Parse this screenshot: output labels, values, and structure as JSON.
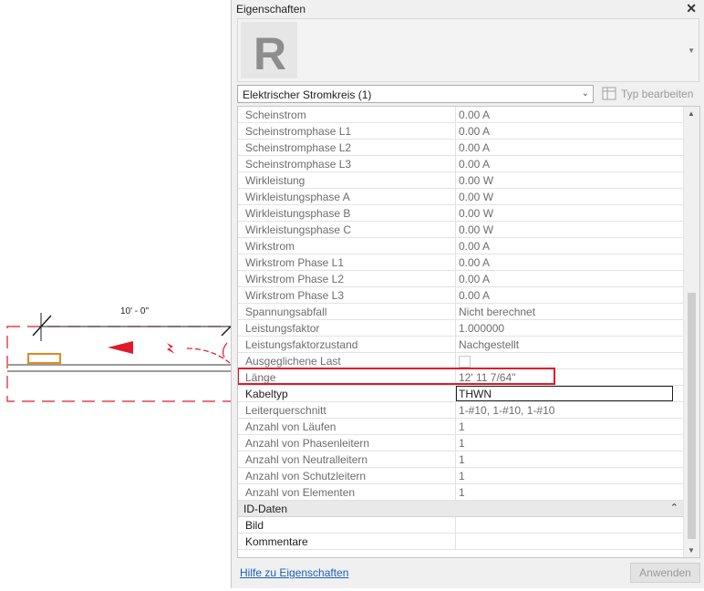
{
  "drawing": {
    "dimension_text": "10' - 0\""
  },
  "panel": {
    "title": "Eigenschaften",
    "close_glyph": "✕",
    "logo_letter": "R",
    "type_selector": "Elektrischer Stromkreis (1)",
    "edit_type_label": "Typ bearbeiten",
    "properties": [
      {
        "label": "Scheinstrom",
        "value": "0.00 A"
      },
      {
        "label": "Scheinstromphase L1",
        "value": "0.00 A"
      },
      {
        "label": "Scheinstromphase L2",
        "value": "0.00 A"
      },
      {
        "label": "Scheinstromphase L3",
        "value": "0.00 A"
      },
      {
        "label": "Wirkleistung",
        "value": "0.00 W"
      },
      {
        "label": "Wirkleistungsphase A",
        "value": "0.00 W"
      },
      {
        "label": "Wirkleistungsphase B",
        "value": "0.00 W"
      },
      {
        "label": "Wirkleistungsphase C",
        "value": "0.00 W"
      },
      {
        "label": "Wirkstrom",
        "value": "0.00 A"
      },
      {
        "label": "Wirkstrom Phase L1",
        "value": "0.00 A"
      },
      {
        "label": "Wirkstrom Phase L2",
        "value": "0.00 A"
      },
      {
        "label": "Wirkstrom Phase L3",
        "value": "0.00 A"
      },
      {
        "label": "Spannungsabfall",
        "value": "Nicht berechnet"
      },
      {
        "label": "Leistungsfaktor",
        "value": "1.000000"
      },
      {
        "label": "Leistungsfaktorzustand",
        "value": "Nachgestellt"
      },
      {
        "label": "Ausgeglichene Last",
        "value": ""
      },
      {
        "label": "Länge",
        "value": "12'  11 7/64\""
      },
      {
        "label": "Kabeltyp",
        "value": "THWN"
      },
      {
        "label": "Leiterquerschnitt",
        "value": "1-#10, 1-#10, 1-#10"
      },
      {
        "label": "Anzahl von Läufen",
        "value": "1"
      },
      {
        "label": "Anzahl von Phasenleitern",
        "value": "1"
      },
      {
        "label": "Anzahl von Neutralleitern",
        "value": "1"
      },
      {
        "label": "Anzahl von Schutzleitern",
        "value": "1"
      },
      {
        "label": "Anzahl von Elementen",
        "value": "1"
      }
    ],
    "group_id": "ID-Daten",
    "group_toggle": "⌃",
    "id_fields": [
      {
        "label": "Bild",
        "value": ""
      },
      {
        "label": "Kommentare",
        "value": ""
      }
    ],
    "help_link": "Hilfe zu Eigenschaften",
    "apply_button": "Anwenden"
  },
  "colors": {
    "highlight": "#e0192a",
    "link": "#1c5fb8",
    "drawing_red": "#e0192a",
    "fixture_orange": "#e08a1e"
  }
}
